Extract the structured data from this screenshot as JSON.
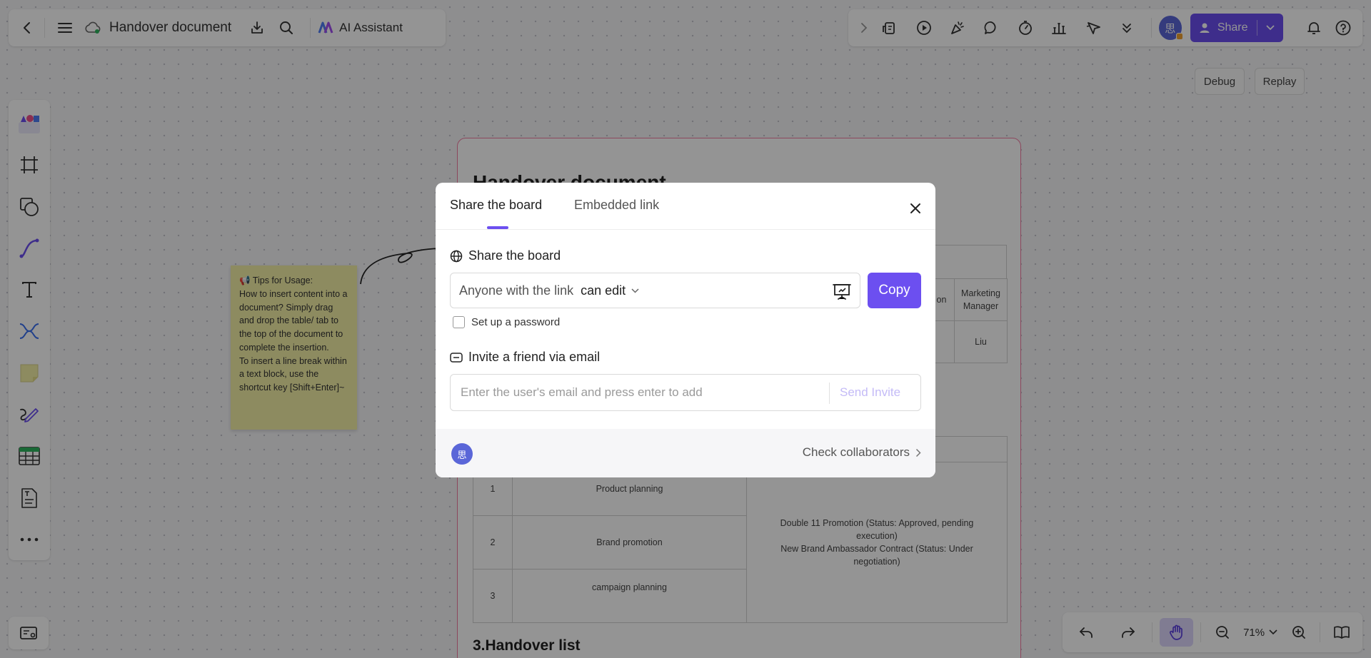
{
  "header": {
    "doc_title": "Handover document",
    "ai_assistant_label": "AI Assistant",
    "avatar_char": "思",
    "share_label": "Share"
  },
  "canvas_buttons": {
    "debug": "Debug",
    "replay": "Replay"
  },
  "document": {
    "title": "Handover document",
    "section3_title": "3.Handover list",
    "staff_table": {
      "col_partial": "on",
      "col_last": "Marketing Manager",
      "last_value": "Liu"
    },
    "task_rows": [
      {
        "num": "1",
        "task": "Product planning"
      },
      {
        "num": "2",
        "task": "Brand promotion"
      },
      {
        "num": "3",
        "task": "campaign planning"
      }
    ],
    "task_details": [
      "Double 11 Promotion (Status: Approved, pending execution)",
      "New Brand Ambassador Contract (Status: Under negotiation)"
    ]
  },
  "sticky_note": {
    "lines": [
      "📢 Tips for Usage:",
      "How to insert content into a document? Simply drag and drop the table/ tab to the top of the document to complete the insertion.",
      "To insert a line break within a text block, use the shortcut key [Shift+Enter]~"
    ]
  },
  "modal": {
    "tab_share": "Share the board",
    "tab_embed": "Embedded link",
    "share_heading": "Share the board",
    "link_scope": "Anyone with the link",
    "link_permission": "can edit",
    "copy_label": "Copy",
    "password_label": "Set up a password",
    "invite_heading": "Invite a friend via email",
    "email_placeholder": "Enter the user's email and press enter to add",
    "send_invite_label": "Send Invite",
    "avatar_char": "思",
    "check_collaborators_label": "Check collaborators"
  },
  "zoom": {
    "level": "71%"
  },
  "colors": {
    "accent": "#6c4ff0",
    "avatar": "#5a66d8",
    "frame_border": "#f07aa0",
    "sticky": "#f3efa6"
  }
}
